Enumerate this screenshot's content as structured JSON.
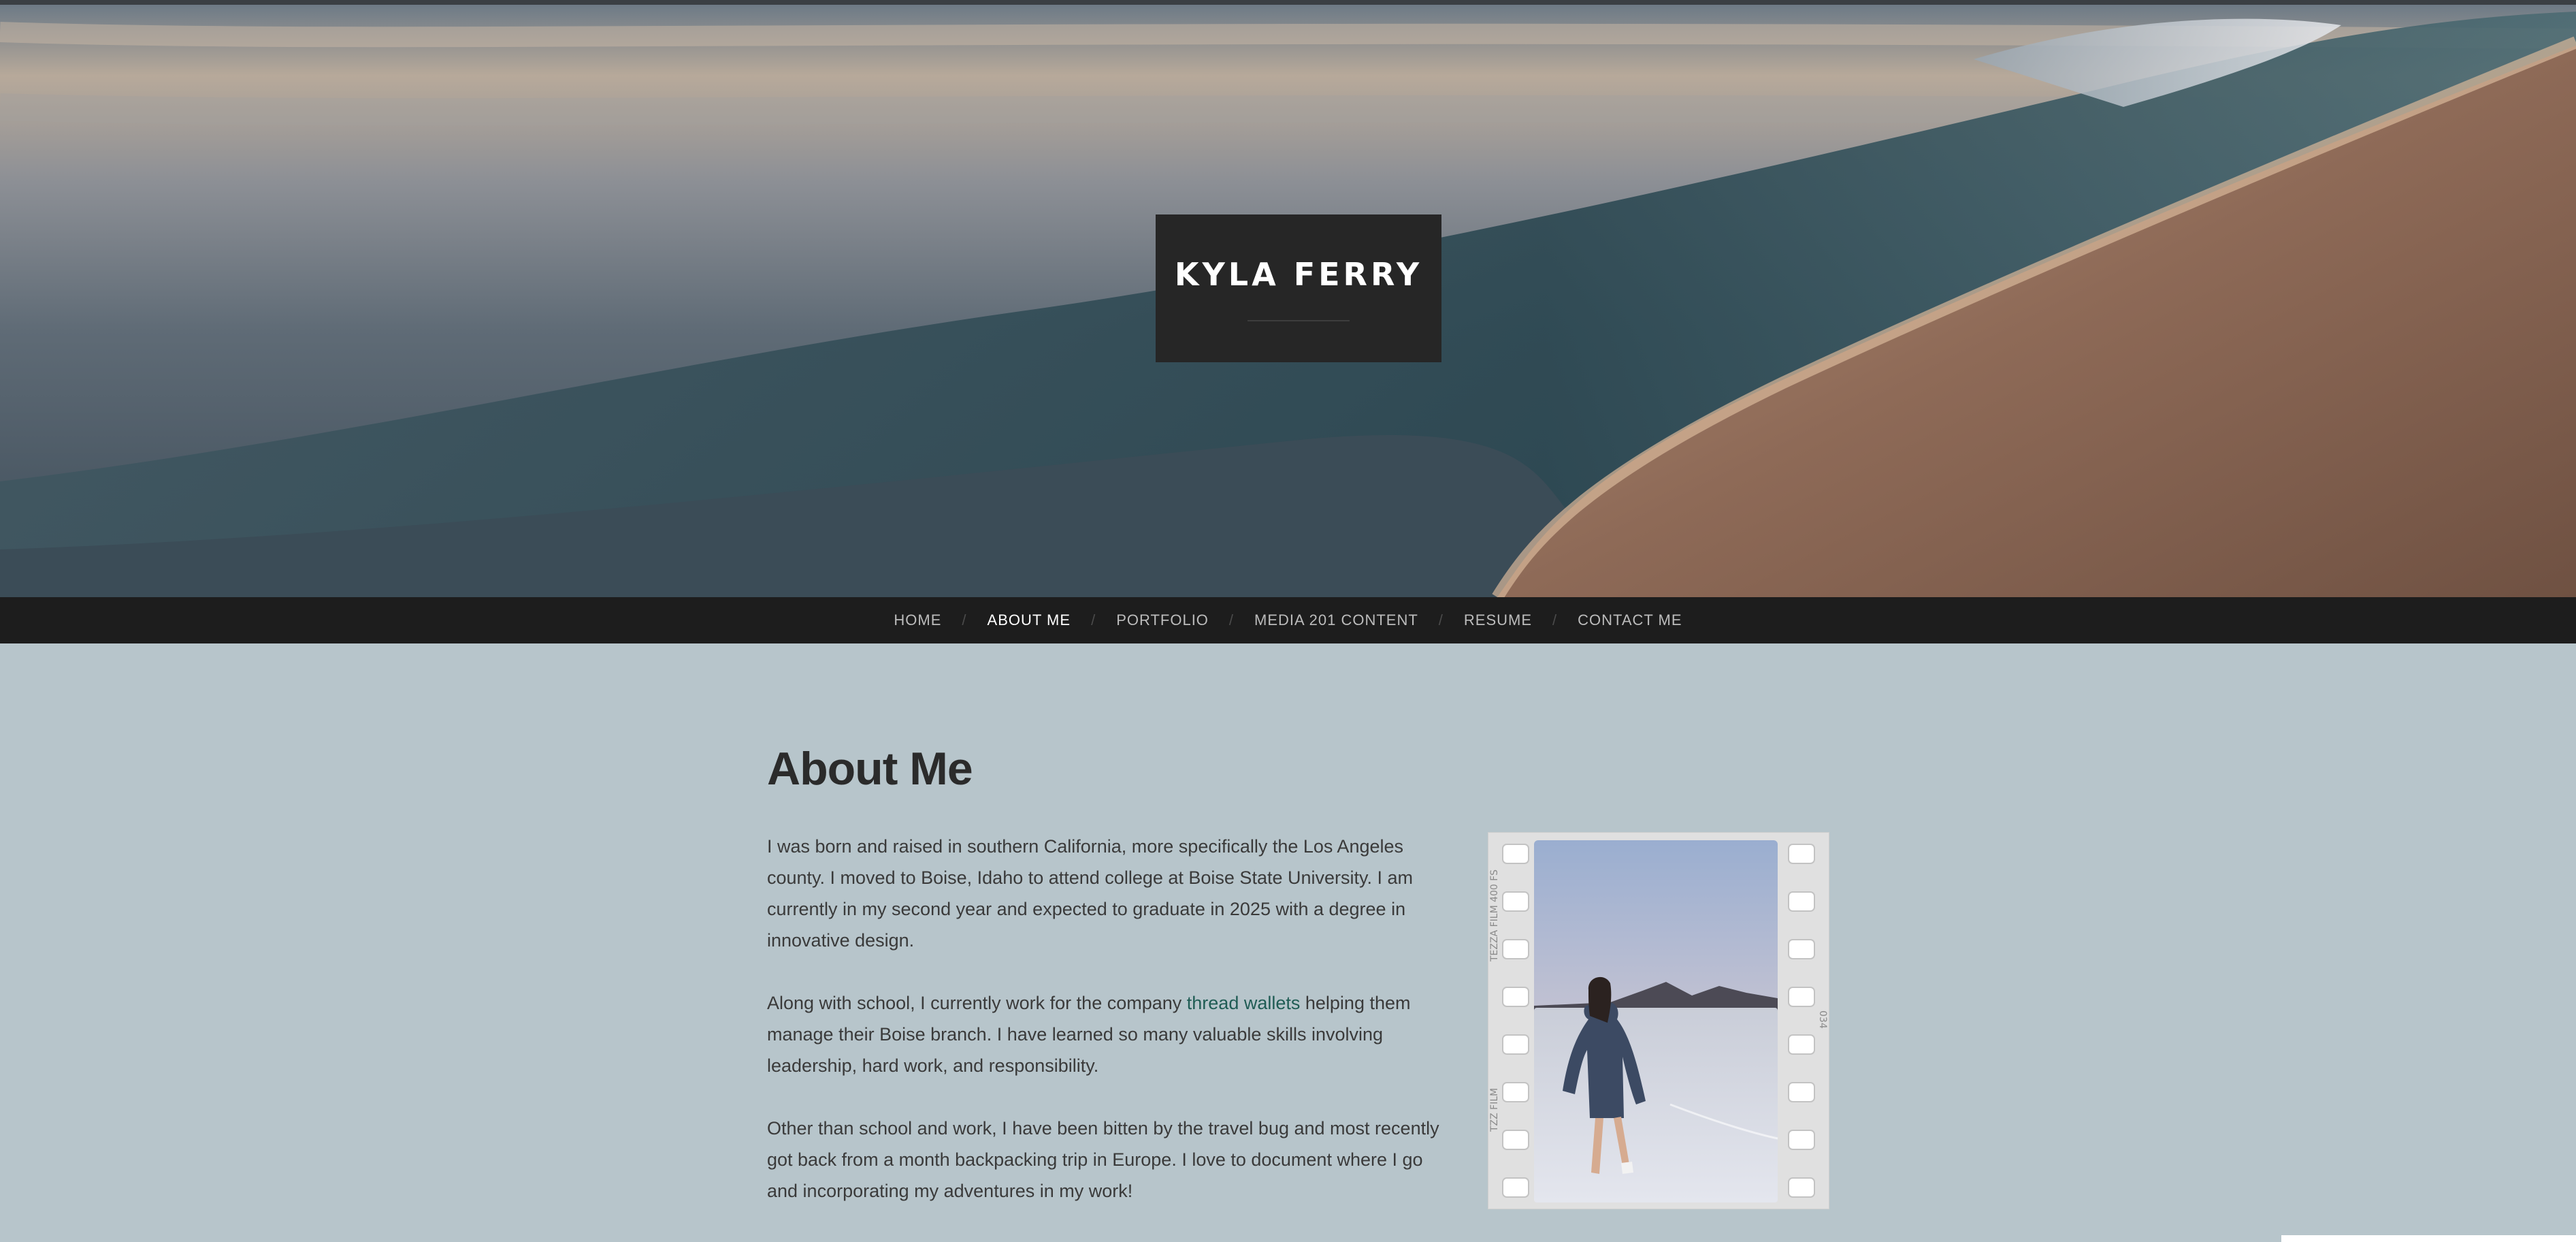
{
  "site": {
    "title": "KYLA FERRY"
  },
  "nav": {
    "items": [
      {
        "label": "HOME"
      },
      {
        "label": "ABOUT ME"
      },
      {
        "label": "PORTFOLIO"
      },
      {
        "label": "MEDIA 201 CONTENT"
      },
      {
        "label": "RESUME"
      },
      {
        "label": "CONTACT ME"
      }
    ],
    "separator": "/",
    "active_index": 1
  },
  "page": {
    "title": "About Me",
    "paragraphs": [
      {
        "text": "I was born and raised in southern California, more specifically the Los Angeles county. I moved to Boise, Idaho to attend college at Boise State University. I am currently in my second year and expected to graduate in 2025 with a degree in innovative design."
      },
      {
        "before": "Along with school, I currently work for the company ",
        "link": "thread wallets",
        "after": " helping them manage their Boise branch. I have learned so many valuable skills involving leadership, hard work, and responsibility."
      },
      {
        "text": "Other than school and work, I have been bitten by the travel bug and most recently got back from a month backpacking trip in Europe. I love to document where I go and incorporating my adventures in my work!"
      }
    ]
  },
  "photo": {
    "film_text_top": "TEZZA FILM 400 FS",
    "film_text_bottom": "TZZ FILM",
    "film_number": "034"
  },
  "colors": {
    "page_bg": "#b7c5cb",
    "nav_bg": "#1d1d1d",
    "title_box_bg": "#262626",
    "link": "#1f5c54",
    "heading": "#2b2b2b"
  }
}
